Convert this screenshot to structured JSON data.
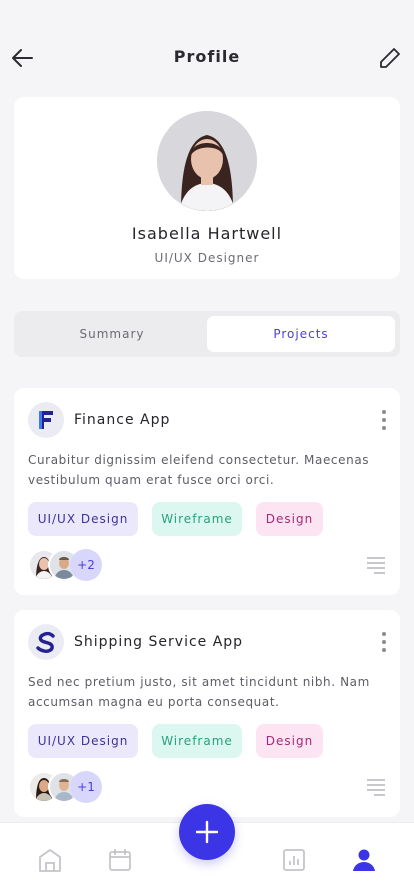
{
  "header": {
    "title": "Profile"
  },
  "profile": {
    "name": "Isabella Hartwell",
    "role": "UI/UX Designer"
  },
  "tabs": [
    {
      "label": "Summary",
      "active": false
    },
    {
      "label": "Projects",
      "active": true
    }
  ],
  "projects": [
    {
      "logo_letter": "F",
      "title": "Finance App",
      "description": "Curabitur dignissim eleifend consectetur. Maecenas vestibulum quam erat fusce orci orci.",
      "tags": [
        "UI/UX Design",
        "Wireframe",
        "Design"
      ],
      "more_members": "+2"
    },
    {
      "logo_letter": "S",
      "title": "Shipping Service App",
      "description": "Sed nec pretium justo, sit amet tincidunt nibh. Nam accumsan magna eu porta consequat.",
      "tags": [
        "UI/UX Design",
        "Wireframe",
        "Design"
      ],
      "more_members": "+1"
    }
  ],
  "bottom_nav": [
    "home-icon",
    "calendar-icon",
    "add-icon",
    "chart-icon",
    "user-icon"
  ],
  "colors": {
    "accent": "#3c35e5",
    "tag_uiux": "#ebe8fc",
    "tag_wireframe": "#dbf7ef",
    "tag_design": "#fde4f3"
  }
}
